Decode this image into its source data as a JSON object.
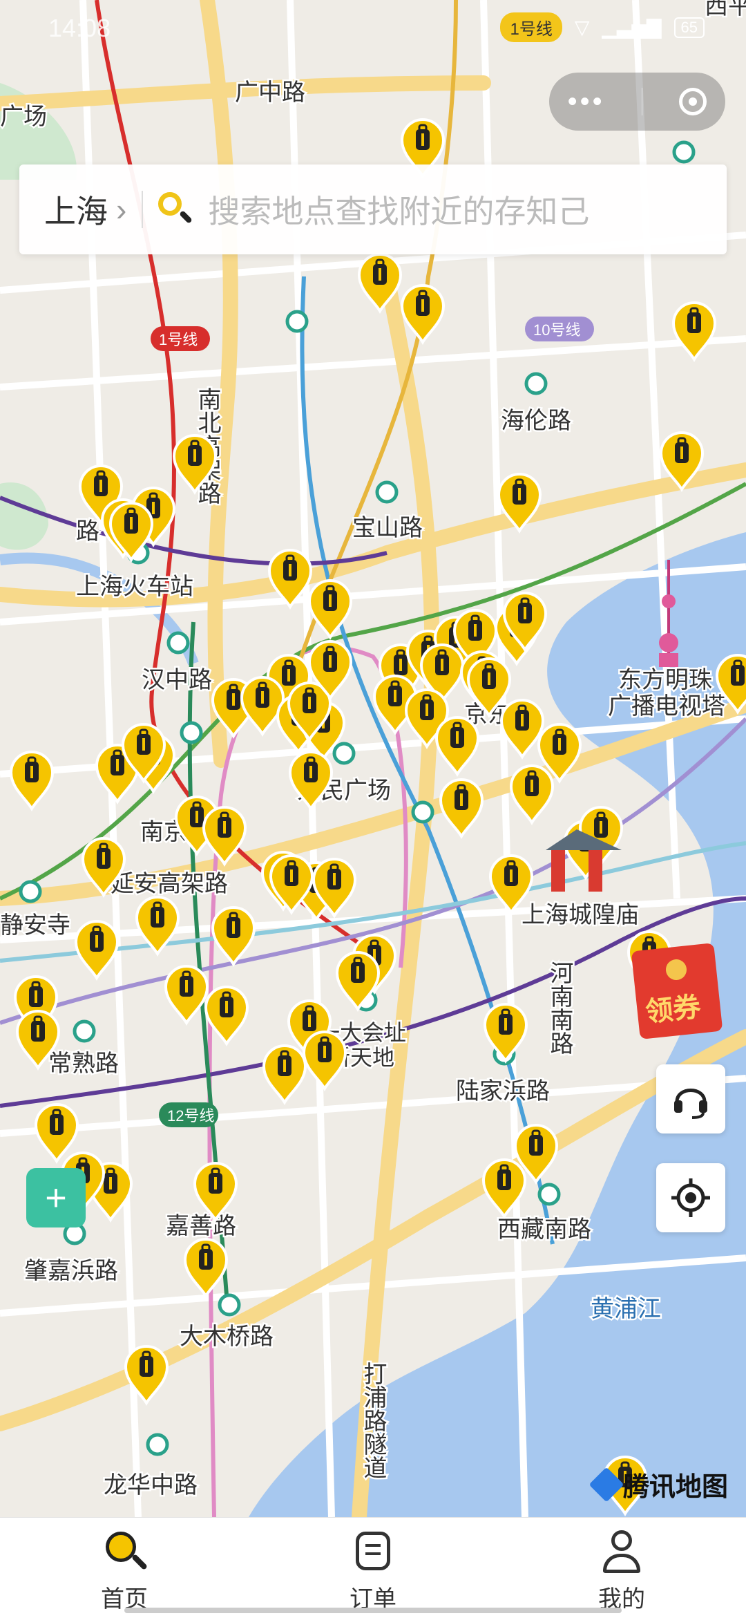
{
  "status": {
    "time": "14:08",
    "metro_badge": "1号线",
    "battery": "65"
  },
  "search": {
    "city": "上海",
    "placeholder": "搜索地点查找附近的存知己"
  },
  "map": {
    "colors": {
      "line1": "#d72e2c",
      "line2": "#53a548",
      "line4": "#5e3b96",
      "line8": "#4aa0d8",
      "line9": "#8ccadc",
      "line10": "#a18fd2",
      "line12": "#2a8a5a",
      "line13": "#e08bc5",
      "road_major": "#f7d98a",
      "road_minor": "#ffffff",
      "water": "#a7c8ef",
      "park": "#cfe8cf",
      "pin": "#f5c400"
    },
    "line_badges": [
      {
        "label": "1号线"
      },
      {
        "label": "10号线"
      },
      {
        "label": "12号线"
      }
    ],
    "labels": [
      {
        "text": "广中路"
      },
      {
        "text": "广场"
      },
      {
        "text": "南北高架路"
      },
      {
        "text": "海伦路"
      },
      {
        "text": "宝山路"
      },
      {
        "text": "上海火车站"
      },
      {
        "text": "汉中路"
      },
      {
        "text": "东方明珠广播电视塔"
      },
      {
        "text": "南京"
      },
      {
        "text": "延安高架路"
      },
      {
        "text": "静安寺"
      },
      {
        "text": "人民广场"
      },
      {
        "text": "上海城隍庙"
      },
      {
        "text": "河南南路"
      },
      {
        "text": "一大会址·新天地"
      },
      {
        "text": "常熟路"
      },
      {
        "text": "陆家浜路"
      },
      {
        "text": "嘉善路"
      },
      {
        "text": "西藏南路"
      },
      {
        "text": "肇嘉浜路"
      },
      {
        "text": "黄浦江"
      },
      {
        "text": "大木桥路"
      },
      {
        "text": "打浦路隧道"
      },
      {
        "text": "龙华中路"
      },
      {
        "text": "西平"
      },
      {
        "text": "京东"
      },
      {
        "text": "路"
      }
    ],
    "pin_icon": "luggage-icon"
  },
  "buttons": {
    "coupon_label": "领券",
    "support_icon": "headset-icon",
    "locate_icon": "locate-icon",
    "safety_icon": "shield-plus-icon"
  },
  "watermark": {
    "brand": "腾讯地图"
  },
  "nav": [
    {
      "label": "首页",
      "icon": "search-icon",
      "active": true
    },
    {
      "label": "订单",
      "icon": "order-icon",
      "active": false
    },
    {
      "label": "我的",
      "icon": "profile-icon",
      "active": false
    }
  ]
}
